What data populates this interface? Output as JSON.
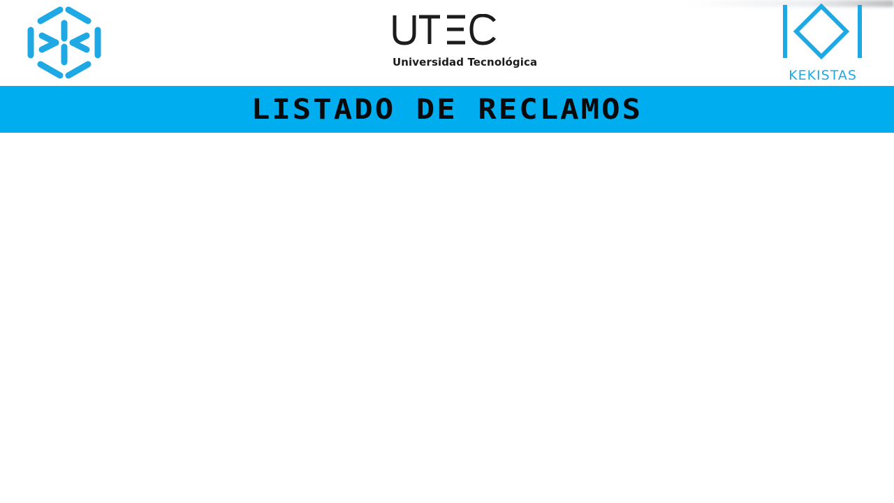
{
  "header": {
    "left_logo": {
      "icon": "hexagon-cube-logo-icon",
      "color": "#1fa9e4"
    },
    "center_logo": {
      "wordmark": "UTEC",
      "subtitle": "Universidad Tecnológica",
      "color": "#1c1c1c"
    },
    "right_logo": {
      "icon": "kekistas-logo-icon",
      "label": "KEKISTAS",
      "color": "#1fa9e4"
    }
  },
  "banner": {
    "title": "LISTADO DE RECLAMOS",
    "background": "#00adef",
    "text_color": "#0a0a0a"
  },
  "content": {}
}
